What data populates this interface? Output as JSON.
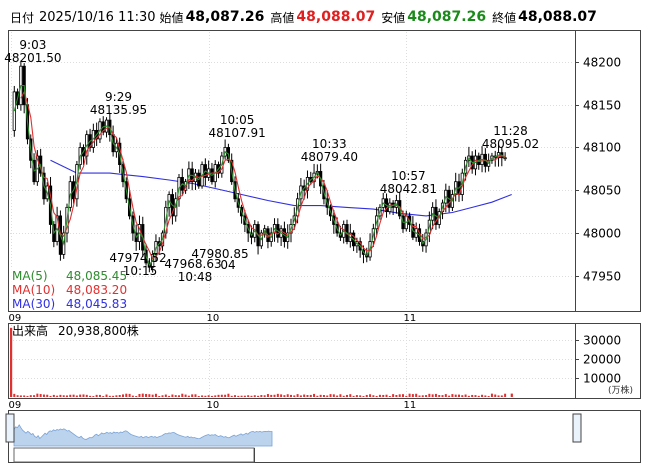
{
  "header": {
    "date_label": "日付",
    "datetime": "2025/10/16 11:30",
    "open_label": "始値",
    "open": "48,087.26",
    "high_label": "高値",
    "high": "48,088.07",
    "low_label": "安値",
    "low": "48,087.26",
    "close_label": "終値",
    "close": "48,088.07"
  },
  "ma_legend": [
    {
      "label": "MA(5)",
      "value": "48,085.45",
      "color": "#2e8b2e"
    },
    {
      "label": "MA(10)",
      "value": "48,083.20",
      "color": "#e03030"
    },
    {
      "label": "MA(30)",
      "value": "48,045.83",
      "color": "#3030e0"
    }
  ],
  "volume_label": "出来高",
  "volume_value": "20,938,800株",
  "volume_unit": "(万株)",
  "chart_data": [
    {
      "type": "candlestick",
      "ylim": [
        47910,
        48235
      ],
      "yticks": [
        47950,
        48000,
        48050,
        48100,
        48150,
        48200
      ],
      "xtick_labels": [
        {
          "t": 0,
          "label": "09"
        },
        {
          "t": 60,
          "label": "10"
        },
        {
          "t": 120,
          "label": "11"
        }
      ],
      "annotations": [
        {
          "t": 3,
          "time": "9:03",
          "price": "48201.50",
          "kind": "high"
        },
        {
          "t": 29,
          "time": "9:29",
          "price": "48135.95",
          "kind": "high"
        },
        {
          "t": 65,
          "time": "10:05",
          "price": "48107.91",
          "kind": "high"
        },
        {
          "t": 93,
          "time": "10:33",
          "price": "48079.40",
          "kind": "high"
        },
        {
          "t": 117,
          "time": "10:57",
          "price": "48042.81",
          "kind": "high"
        },
        {
          "t": 148,
          "time": "11:28",
          "price": "48095.02",
          "kind": "high"
        },
        {
          "t": 75,
          "time": "10:15",
          "price": "47974.52",
          "kind": "low"
        },
        {
          "t": 108,
          "time": "10:48",
          "price": "47968.63",
          "kind": "low"
        },
        {
          "t": 125,
          "time": "",
          "price": "47980.85",
          "kind": "low"
        },
        {
          "t": 122,
          "time": "",
          "price": "04",
          "kind": "low"
        }
      ],
      "close_path": [
        [
          0,
          48120
        ],
        [
          1,
          48165
        ],
        [
          2,
          48150
        ],
        [
          3,
          48195
        ],
        [
          4,
          48150
        ],
        [
          5,
          48110
        ],
        [
          6,
          48085
        ],
        [
          7,
          48060
        ],
        [
          8,
          48090
        ],
        [
          9,
          48070
        ],
        [
          10,
          48040
        ],
        [
          11,
          48055
        ],
        [
          12,
          48010
        ],
        [
          13,
          47990
        ],
        [
          14,
          48020
        ],
        [
          15,
          47975
        ],
        [
          16,
          48000
        ],
        [
          17,
          48030
        ],
        [
          18,
          48060
        ],
        [
          19,
          48040
        ],
        [
          20,
          48080
        ],
        [
          21,
          48100
        ],
        [
          22,
          48090
        ],
        [
          23,
          48115
        ],
        [
          24,
          48100
        ],
        [
          25,
          48120
        ],
        [
          26,
          48110
        ],
        [
          27,
          48130
        ],
        [
          28,
          48118
        ],
        [
          29,
          48132
        ],
        [
          30,
          48115
        ],
        [
          31,
          48095
        ],
        [
          32,
          48105
        ],
        [
          33,
          48080
        ],
        [
          34,
          48060
        ],
        [
          35,
          48040
        ],
        [
          36,
          48020
        ],
        [
          37,
          48000
        ],
        [
          38,
          47990
        ],
        [
          39,
          48010
        ],
        [
          40,
          47980
        ],
        [
          41,
          47965
        ],
        [
          42,
          47960
        ],
        [
          43,
          47975
        ],
        [
          44,
          47990
        ],
        [
          45,
          47985
        ],
        [
          46,
          48000
        ],
        [
          47,
          48030
        ],
        [
          48,
          48045
        ],
        [
          49,
          48020
        ],
        [
          50,
          48040
        ],
        [
          51,
          48065
        ],
        [
          52,
          48050
        ],
        [
          53,
          48060
        ],
        [
          54,
          48075
        ],
        [
          55,
          48060
        ],
        [
          56,
          48070
        ],
        [
          57,
          48055
        ],
        [
          58,
          48080
        ],
        [
          59,
          48065
        ],
        [
          60,
          48075
        ],
        [
          61,
          48060
        ],
        [
          62,
          48080
        ],
        [
          63,
          48070
        ],
        [
          64,
          48090
        ],
        [
          65,
          48100
        ],
        [
          66,
          48085
        ],
        [
          67,
          48060
        ],
        [
          68,
          48040
        ],
        [
          69,
          48030
        ],
        [
          70,
          48020
        ],
        [
          71,
          48010
        ],
        [
          72,
          48000
        ],
        [
          73,
          47995
        ],
        [
          74,
          48010
        ],
        [
          75,
          47985
        ],
        [
          76,
          48000
        ],
        [
          77,
          48005
        ],
        [
          78,
          47990
        ],
        [
          79,
          48000
        ],
        [
          80,
          48010
        ],
        [
          81,
          47995
        ],
        [
          82,
          48005
        ],
        [
          83,
          47990
        ],
        [
          84,
          48000
        ],
        [
          85,
          48010
        ],
        [
          86,
          48020
        ],
        [
          87,
          48040
        ],
        [
          88,
          48055
        ],
        [
          89,
          48050
        ],
        [
          90,
          48065
        ],
        [
          91,
          48060
        ],
        [
          92,
          48070
        ],
        [
          93,
          48072
        ],
        [
          94,
          48055
        ],
        [
          95,
          48040
        ],
        [
          96,
          48030
        ],
        [
          97,
          48020
        ],
        [
          98,
          48010
        ],
        [
          99,
          48000
        ],
        [
          100,
          47995
        ],
        [
          101,
          48010
        ],
        [
          102,
          47990
        ],
        [
          103,
          48000
        ],
        [
          104,
          47985
        ],
        [
          105,
          47990
        ],
        [
          106,
          47980
        ],
        [
          107,
          47975
        ],
        [
          108,
          47972
        ],
        [
          109,
          47990
        ],
        [
          110,
          48005
        ],
        [
          111,
          48020
        ],
        [
          112,
          48030
        ],
        [
          113,
          48040
        ],
        [
          114,
          48025
        ],
        [
          115,
          48035
        ],
        [
          116,
          48030
        ],
        [
          117,
          48038
        ],
        [
          118,
          48020
        ],
        [
          119,
          48005
        ],
        [
          120,
          48020
        ],
        [
          121,
          48010
        ],
        [
          122,
          47995
        ],
        [
          123,
          48005
        ],
        [
          124,
          47990
        ],
        [
          125,
          47985
        ],
        [
          126,
          48000
        ],
        [
          127,
          48015
        ],
        [
          128,
          48030
        ],
        [
          129,
          48010
        ],
        [
          130,
          48025
        ],
        [
          131,
          48035
        ],
        [
          132,
          48050
        ],
        [
          133,
          48030
        ],
        [
          134,
          48045
        ],
        [
          135,
          48060
        ],
        [
          136,
          48045
        ],
        [
          137,
          48070
        ],
        [
          138,
          48085
        ],
        [
          139,
          48090
        ],
        [
          140,
          48075
        ],
        [
          141,
          48090
        ],
        [
          142,
          48080
        ],
        [
          143,
          48092
        ],
        [
          144,
          48078
        ],
        [
          145,
          48085
        ],
        [
          146,
          48090
        ],
        [
          147,
          48088
        ],
        [
          148,
          48094
        ],
        [
          149,
          48088
        ],
        [
          150,
          48088
        ]
      ],
      "ma30_path": [
        [
          12,
          48085
        ],
        [
          20,
          48070
        ],
        [
          30,
          48070
        ],
        [
          40,
          48066
        ],
        [
          48,
          48062
        ],
        [
          55,
          48058
        ],
        [
          62,
          48052
        ],
        [
          70,
          48045
        ],
        [
          78,
          48038
        ],
        [
          86,
          48032
        ],
        [
          94,
          48032
        ],
        [
          102,
          48030
        ],
        [
          110,
          48028
        ],
        [
          118,
          48023
        ],
        [
          126,
          48020
        ],
        [
          134,
          48024
        ],
        [
          140,
          48030
        ],
        [
          146,
          48036
        ],
        [
          152,
          48045
        ]
      ]
    },
    {
      "type": "bar",
      "title": "出来高",
      "ylim": [
        0,
        38000
      ],
      "yticks": [
        10000,
        20000,
        30000
      ],
      "ylabel": "(万株)",
      "spikes": [
        [
          0,
          36500
        ],
        [
          152,
          1800
        ]
      ]
    }
  ]
}
